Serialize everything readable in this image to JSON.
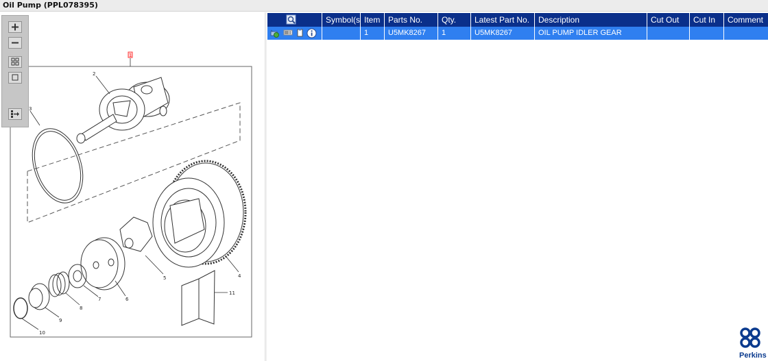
{
  "window": {
    "title": "Oil Pump (PPL078395)"
  },
  "viewer": {
    "toolbar": [
      {
        "name": "zoom-in",
        "icon": "plus-icon"
      },
      {
        "name": "zoom-out",
        "icon": "minus-icon"
      },
      {
        "name": "fit-all",
        "icon": "grid-icon"
      },
      {
        "name": "actual-size",
        "icon": "square-icon"
      },
      {
        "name": "export-to-list",
        "icon": "list-arrow-icon"
      }
    ],
    "callouts": [
      "1",
      "2",
      "3",
      "4",
      "5",
      "6",
      "7",
      "8",
      "9",
      "10",
      "11"
    ],
    "highlight_color": "#ff3b3b"
  },
  "parts_table": {
    "columns": [
      "",
      "Symbol(s)",
      "Item",
      "Parts No.",
      "Qty.",
      "Latest Part No.",
      "Description",
      "Cut Out",
      "Cut In",
      "Comment"
    ],
    "rows": [
      {
        "symbols": "",
        "item": "1",
        "parts_no": "U5MK8267",
        "qty": "1",
        "latest_part_no": "U5MK8267",
        "description": "OIL PUMP IDLER GEAR",
        "cut_out": "",
        "cut_in": "",
        "comment": ""
      }
    ],
    "header_color": "#0a2f8a",
    "selected_row_color": "#2f7ff0"
  },
  "brand": {
    "name": "Perkins",
    "color": "#0a3a8e"
  }
}
